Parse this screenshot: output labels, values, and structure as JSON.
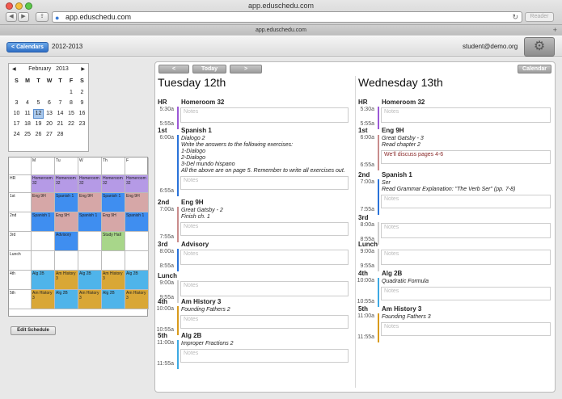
{
  "browser": {
    "window_title": "app.eduschedu.com",
    "url": "app.eduschedu.com",
    "tab_title": "app.eduschedu.com",
    "reader_label": "Reader"
  },
  "header": {
    "calendars_button": "< Calendars",
    "year": "2012-2013",
    "user_email": "student@demo.org"
  },
  "mini_calendar": {
    "month": "February",
    "year": "2013",
    "day_headers": [
      "S",
      "M",
      "T",
      "W",
      "T",
      "F",
      "S"
    ],
    "weeks": [
      [
        "",
        "",
        "",
        "",
        "",
        "1",
        "2"
      ],
      [
        "3",
        "4",
        "5",
        "6",
        "7",
        "8",
        "9"
      ],
      [
        "10",
        "11",
        "12",
        "13",
        "14",
        "15",
        "16"
      ],
      [
        "17",
        "18",
        "19",
        "20",
        "21",
        "22",
        "23"
      ],
      [
        "24",
        "25",
        "26",
        "27",
        "28",
        "",
        ""
      ]
    ],
    "selected_day": "12"
  },
  "schedule": {
    "day_columns": [
      "M",
      "Tu",
      "W",
      "Th",
      "F"
    ],
    "rows": [
      {
        "label": "HR",
        "cells": [
          {
            "text": "Homeroom 32",
            "color": "#b59ae6"
          },
          {
            "text": "Homeroom 32",
            "color": "#b59ae6"
          },
          {
            "text": "Homeroom 32",
            "color": "#b59ae6"
          },
          {
            "text": "Homeroom 32",
            "color": "#b59ae6"
          },
          {
            "text": "Homeroom 32",
            "color": "#b59ae6"
          }
        ]
      },
      {
        "label": "1st",
        "cells": [
          {
            "text": "Eng 9H",
            "color": "#d6a7a7"
          },
          {
            "text": "Spanish 1",
            "color": "#3f8ef0"
          },
          {
            "text": "Eng 9H",
            "color": "#d6a7a7"
          },
          {
            "text": "Spanish 1",
            "color": "#3f8ef0"
          },
          {
            "text": "Eng 9H",
            "color": "#d6a7a7"
          }
        ]
      },
      {
        "label": "2nd",
        "cells": [
          {
            "text": "Spanish 1",
            "color": "#3f8ef0"
          },
          {
            "text": "Eng 9H",
            "color": "#d6a7a7"
          },
          {
            "text": "Spanish 1",
            "color": "#3f8ef0"
          },
          {
            "text": "Eng 9H",
            "color": "#d6a7a7"
          },
          {
            "text": "Spanish 1",
            "color": "#3f8ef0"
          }
        ]
      },
      {
        "label": "3rd",
        "cells": [
          {
            "text": "",
            "color": "#ffffff"
          },
          {
            "text": "Advisory",
            "color": "#3f8ef0"
          },
          {
            "text": "",
            "color": "#ffffff"
          },
          {
            "text": "Study Hall",
            "color": "#a8d68a"
          },
          {
            "text": "",
            "color": "#ffffff"
          }
        ]
      },
      {
        "label": "Lunch",
        "cells": [
          {
            "text": "",
            "color": "#ffffff"
          },
          {
            "text": "",
            "color": "#ffffff"
          },
          {
            "text": "",
            "color": "#ffffff"
          },
          {
            "text": "",
            "color": "#ffffff"
          },
          {
            "text": "",
            "color": "#ffffff"
          }
        ]
      },
      {
        "label": "4th",
        "cells": [
          {
            "text": "Alg 2B",
            "color": "#4fb4ea"
          },
          {
            "text": "Am History 3",
            "color": "#d9a736"
          },
          {
            "text": "Alg 2B",
            "color": "#4fb4ea"
          },
          {
            "text": "Am History 3",
            "color": "#d9a736"
          },
          {
            "text": "Alg 2B",
            "color": "#4fb4ea"
          }
        ]
      },
      {
        "label": "5th",
        "cells": [
          {
            "text": "Am History 3",
            "color": "#d9a736"
          },
          {
            "text": "Alg 2B",
            "color": "#4fb4ea"
          },
          {
            "text": "Am History 3",
            "color": "#d9a736"
          },
          {
            "text": "Alg 2B",
            "color": "#4fb4ea"
          },
          {
            "text": "Am History 3",
            "color": "#d9a736"
          }
        ]
      }
    ],
    "edit_button": "Edit Schedule"
  },
  "toolbar": {
    "prev": "<",
    "today": "Today",
    "next": ">",
    "calendar": "Calendar"
  },
  "days": [
    {
      "title": "Tuesday 12th",
      "periods": [
        {
          "label": "HR",
          "start": "5:30a",
          "end": "5:55a",
          "color": "#9b59d6",
          "course": "Homeroom 32",
          "lines": [],
          "notes": "Notes",
          "notes_filled": false
        },
        {
          "label": "1st",
          "start": "6:00a",
          "end": "6:55a",
          "color": "#2a72d9",
          "course": "Spanish 1",
          "lines": [
            "Dialogo 2",
            "Write the answers to the following exercises:",
            "1-Dialogo",
            "2-Dialogo",
            "3-Del mundo hispano",
            "All the above are on page 5.  Remember to write all exercises out."
          ],
          "notes": "Notes",
          "notes_filled": false
        },
        {
          "label": "2nd",
          "start": "7:00a",
          "end": "7:55a",
          "color": "#c98c8c",
          "course": "Eng 9H",
          "lines": [
            "Great Gatsby - 2",
            "Finish ch. 1"
          ],
          "notes": "Notes",
          "notes_filled": false
        },
        {
          "label": "3rd",
          "start": "8:00a",
          "end": "8:55a",
          "color": "#2a72d9",
          "course": "Advisory",
          "lines": [],
          "notes": "Notes",
          "notes_filled": false
        },
        {
          "label": "Lunch",
          "start": "9:00a",
          "end": "9:55a",
          "color": "#cfcfcf",
          "course": "",
          "lines": [],
          "notes": "Notes",
          "notes_filled": false
        },
        {
          "label": "4th",
          "start": "10:00a",
          "end": "10:55a",
          "color": "#d99a1c",
          "course": "Am History 3",
          "lines": [
            "Founding Fathers 2"
          ],
          "notes": "Notes",
          "notes_filled": false
        },
        {
          "label": "5th",
          "start": "11:00a",
          "end": "11:55a",
          "color": "#3da9e3",
          "course": "Alg 2B",
          "lines": [
            "Improper Fractions 2"
          ],
          "notes": "Notes",
          "notes_filled": false
        }
      ]
    },
    {
      "title": "Wednesday 13th",
      "periods": [
        {
          "label": "HR",
          "start": "5:30a",
          "end": "5:55a",
          "color": "#9b59d6",
          "course": "Homeroom 32",
          "lines": [],
          "notes": "Notes",
          "notes_filled": false
        },
        {
          "label": "1st",
          "start": "6:00a",
          "end": "6:55a",
          "color": "#c98c8c",
          "course": "Eng 9H",
          "lines": [
            "Great Gatsby - 3",
            "Read chapter 2"
          ],
          "notes": "We'll discuss pages 4-6",
          "notes_filled": true
        },
        {
          "label": "2nd",
          "start": "7:00a",
          "end": "7:55a",
          "color": "#2a72d9",
          "course": "Spanish 1",
          "lines": [
            "Ser",
            "Read Grammar Explanation: \"The Verb Ser\" (pp. 7-8)"
          ],
          "notes": "Notes",
          "notes_filled": false
        },
        {
          "label": "3rd",
          "start": "8:00a",
          "end": "8:55a",
          "color": "#cfcfcf",
          "course": "",
          "lines": [],
          "notes": "Notes",
          "notes_filled": false
        },
        {
          "label": "Lunch",
          "start": "9:00a",
          "end": "9:55a",
          "color": "#cfcfcf",
          "course": "",
          "lines": [],
          "notes": "Notes",
          "notes_filled": false
        },
        {
          "label": "4th",
          "start": "10:00a",
          "end": "10:55a",
          "color": "#3da9e3",
          "course": "Alg 2B",
          "lines": [
            "Quadratic Formula"
          ],
          "notes": "Notes",
          "notes_filled": false
        },
        {
          "label": "5th",
          "start": "11:00a",
          "end": "11:55a",
          "color": "#d99a1c",
          "course": "Am History 3",
          "lines": [
            "Founding Fathers 3"
          ],
          "notes": "Notes",
          "notes_filled": false
        }
      ]
    }
  ]
}
